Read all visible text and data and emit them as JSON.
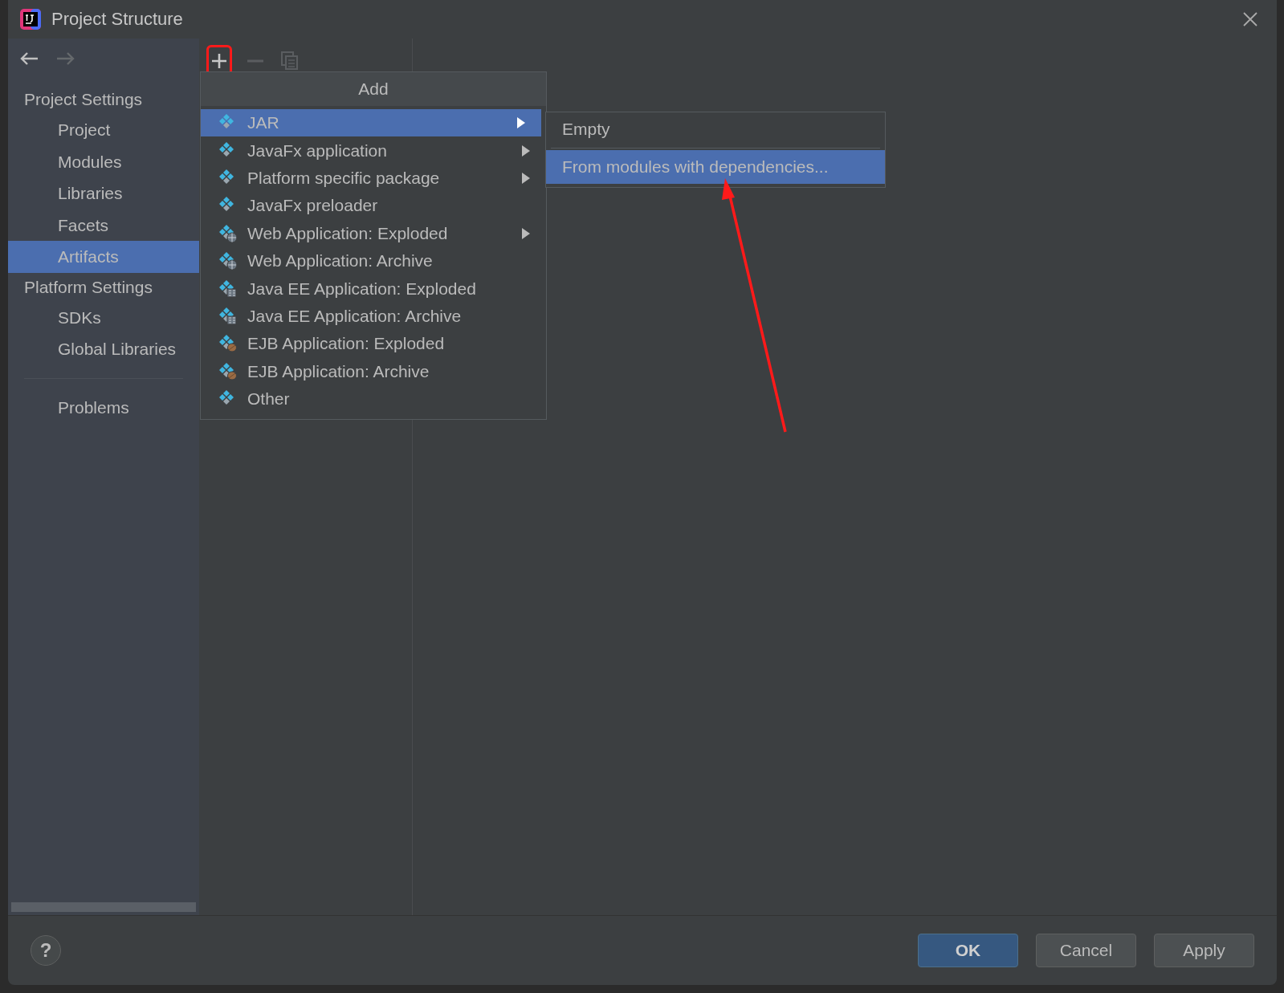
{
  "window": {
    "title": "Project Structure"
  },
  "sidebar": {
    "sections": [
      {
        "label": "Project Settings",
        "items": [
          {
            "label": "Project",
            "selected": false
          },
          {
            "label": "Modules",
            "selected": false
          },
          {
            "label": "Libraries",
            "selected": false
          },
          {
            "label": "Facets",
            "selected": false
          },
          {
            "label": "Artifacts",
            "selected": true
          }
        ]
      },
      {
        "label": "Platform Settings",
        "items": [
          {
            "label": "SDKs",
            "selected": false
          },
          {
            "label": "Global Libraries",
            "selected": false
          }
        ]
      }
    ],
    "extra_items": [
      {
        "label": "Problems",
        "selected": false
      }
    ]
  },
  "add_menu": {
    "title": "Add",
    "items": [
      {
        "label": "JAR",
        "kind": "plain",
        "selected": true,
        "has_submenu": true
      },
      {
        "label": "JavaFx application",
        "kind": "plain",
        "selected": false,
        "has_submenu": true
      },
      {
        "label": "Platform specific package",
        "kind": "plain",
        "selected": false,
        "has_submenu": true
      },
      {
        "label": "JavaFx preloader",
        "kind": "plain",
        "selected": false,
        "has_submenu": false
      },
      {
        "label": "Web Application: Exploded",
        "kind": "web",
        "selected": false,
        "has_submenu": true
      },
      {
        "label": "Web Application: Archive",
        "kind": "web",
        "selected": false,
        "has_submenu": false
      },
      {
        "label": "Java EE Application: Exploded",
        "kind": "javaee",
        "selected": false,
        "has_submenu": false
      },
      {
        "label": "Java EE Application: Archive",
        "kind": "javaee",
        "selected": false,
        "has_submenu": false
      },
      {
        "label": "EJB Application: Exploded",
        "kind": "ejb",
        "selected": false,
        "has_submenu": false
      },
      {
        "label": "EJB Application: Archive",
        "kind": "ejb",
        "selected": false,
        "has_submenu": false
      },
      {
        "label": "Other",
        "kind": "plain",
        "selected": false,
        "has_submenu": false
      }
    ]
  },
  "submenu": {
    "items": [
      {
        "label": "Empty",
        "selected": false
      },
      {
        "label": "From modules with dependencies...",
        "selected": true
      }
    ]
  },
  "help_button": {
    "label": "?"
  },
  "buttons": [
    {
      "label": "OK",
      "kind": "default"
    },
    {
      "label": "Cancel",
      "kind": "normal"
    },
    {
      "label": "Apply",
      "kind": "normal"
    }
  ]
}
